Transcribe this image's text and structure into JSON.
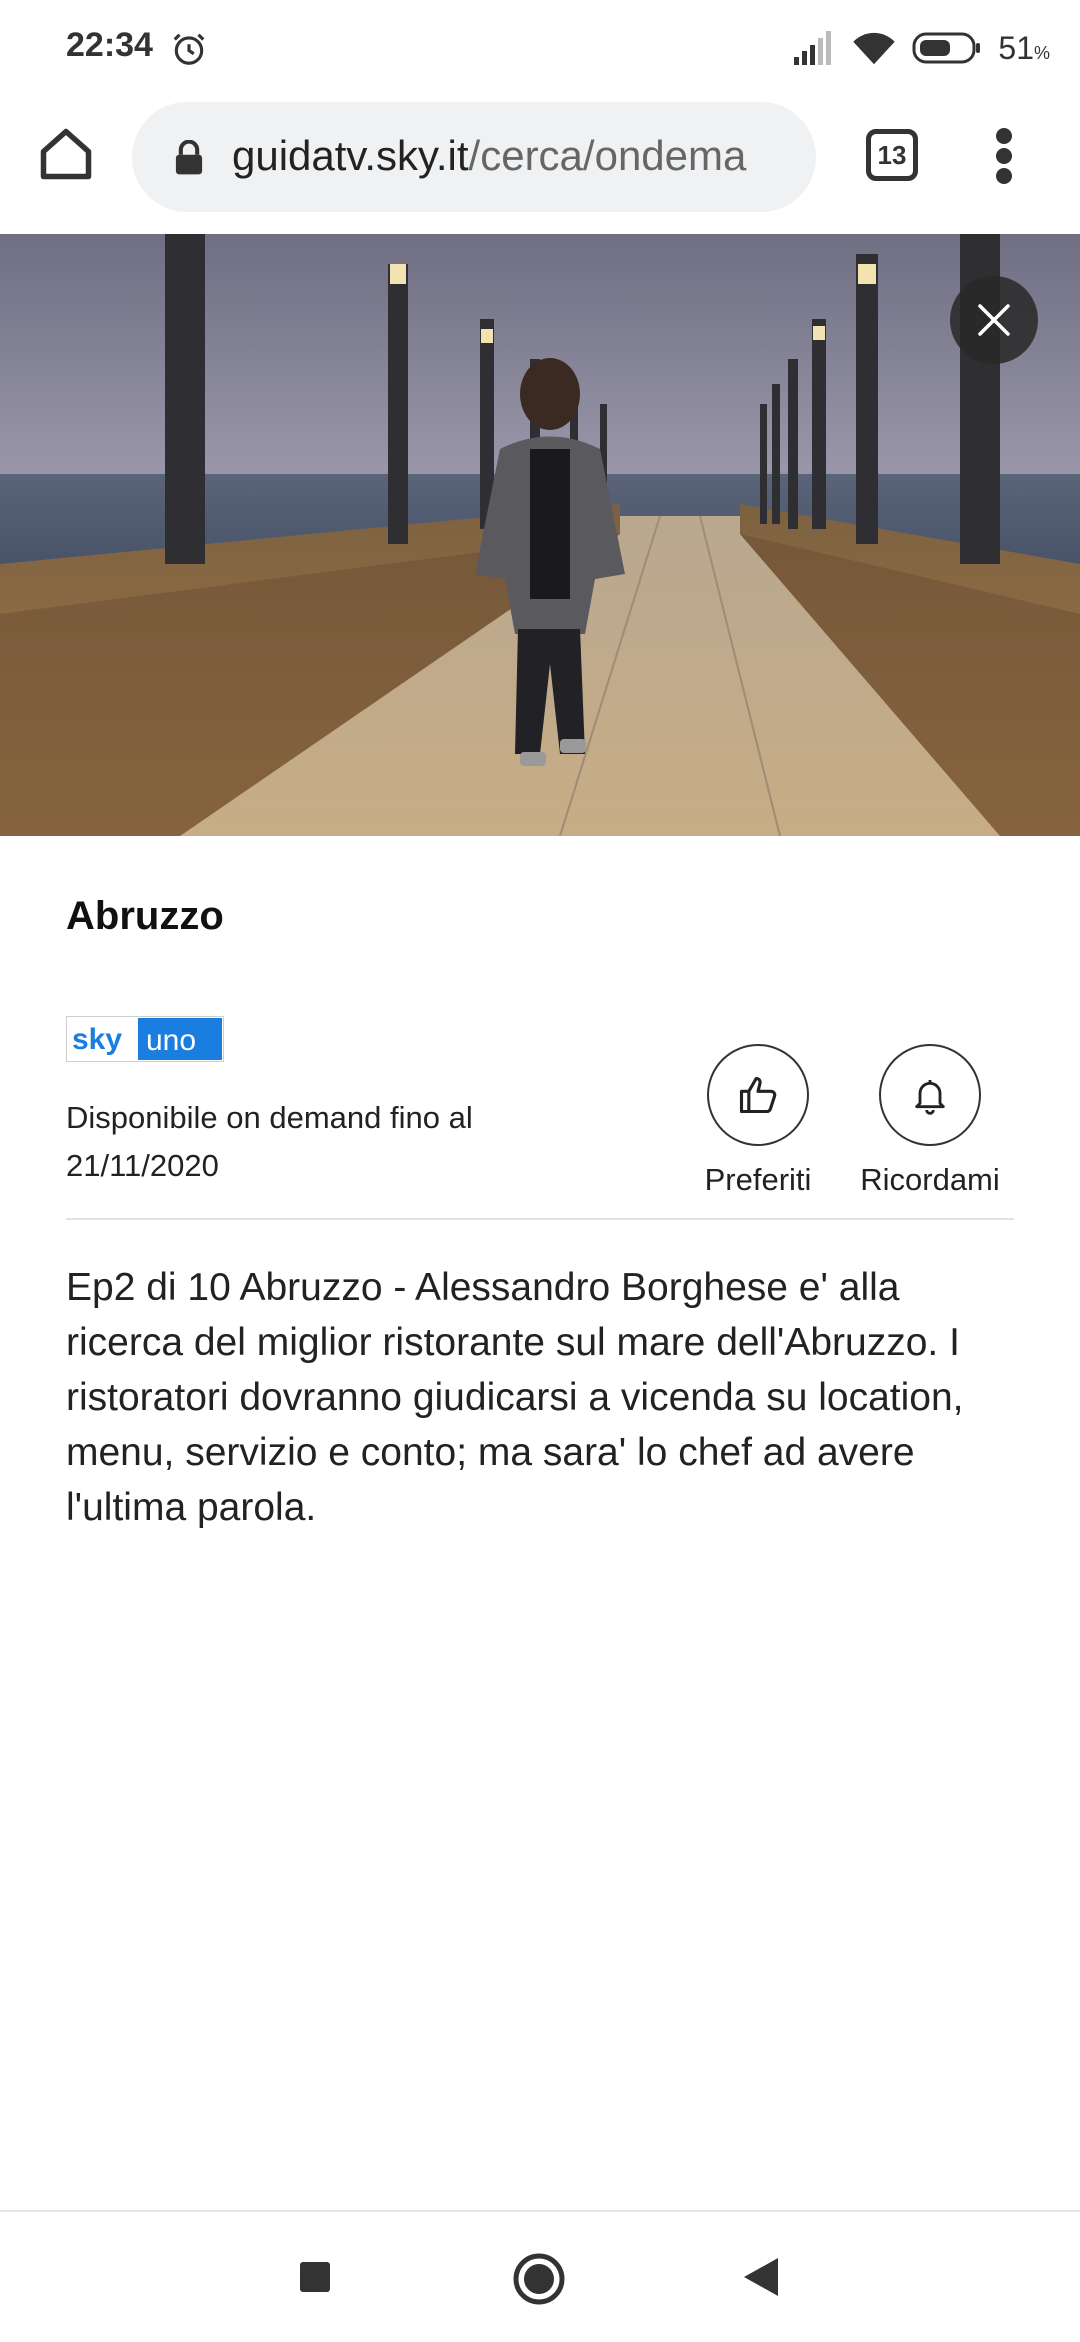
{
  "status_bar": {
    "time": "22:34",
    "battery_percent": "51",
    "battery_unit": "%"
  },
  "browser": {
    "url_domain": "guidatv.sky.it",
    "url_path": "/cerca/ondema",
    "tab_count": "13"
  },
  "program": {
    "title": "Abruzzo",
    "channel_logo": {
      "part1": "sky",
      "part2": "uno"
    },
    "availability": "Disponibile on demand fino al 21/11/2020",
    "description": "Ep2 di 10 Abruzzo - Alessandro Borghese e' alla ricerca del miglior ristorante sul mare dell'Abruzzo. I ristoratori dovranno giudicarsi a vicenda su location, menu, servizio e conto; ma sara' lo chef ad avere l'ultima parola."
  },
  "actions": {
    "favorites_label": "Preferiti",
    "remind_label": "Ricordami"
  },
  "icons": {
    "home": "home-icon",
    "lock": "lock-icon",
    "menu": "more-vert-icon",
    "close": "close-icon",
    "thumbs_up": "thumbs-up-icon",
    "bell": "bell-icon"
  },
  "colors": {
    "sky_blue": "#1a7de0",
    "overlay_dark": "#2a2a2a"
  }
}
